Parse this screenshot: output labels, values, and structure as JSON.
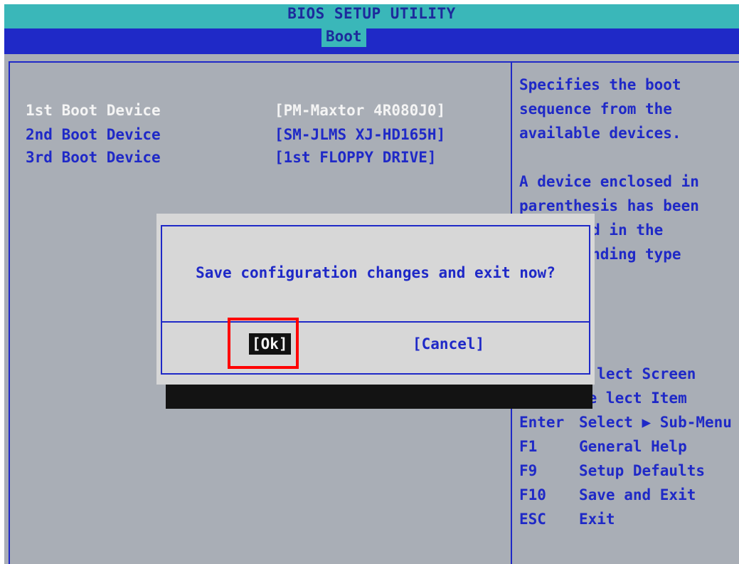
{
  "header": {
    "title": "BIOS SETUP UTILITY",
    "active_tab": "Boot"
  },
  "boot_devices": [
    {
      "label": "1st Boot Device",
      "value": "[PM-Maxtor 4R080J0]"
    },
    {
      "label": "2nd Boot Device",
      "value": "[SM-JLMS XJ-HD165H]"
    },
    {
      "label": "3rd Boot Device",
      "value": "[1st FLOPPY DRIVE]"
    }
  ],
  "help": {
    "lines": [
      "Specifies the boot",
      "sequence from the",
      "available devices.",
      "",
      "A device enclosed in",
      "parenthesis has been",
      "        d in the",
      "        nding type"
    ]
  },
  "keys": [
    {
      "key": "",
      "desc": "  lect Screen"
    },
    {
      "key": "↑↓",
      "desc": "Se lect Item"
    },
    {
      "key": "Enter",
      "desc": "Select ▶ Sub-Menu"
    },
    {
      "key": "F1",
      "desc": "General Help"
    },
    {
      "key": "F9",
      "desc": "Setup Defaults"
    },
    {
      "key": "F10",
      "desc": "Save and Exit"
    },
    {
      "key": "ESC",
      "desc": "Exit"
    }
  ],
  "dialog": {
    "message": "Save configuration changes and exit now?",
    "ok_label": "[Ok]",
    "cancel_label": "[Cancel]"
  },
  "colors": {
    "title_bar": "#3ab7b9",
    "menu_bar": "#1f29c7",
    "background": "#a9aeb6",
    "text_blue": "#1f29c7",
    "text_white": "#f4f4f4",
    "highlight": "#ff0000"
  }
}
